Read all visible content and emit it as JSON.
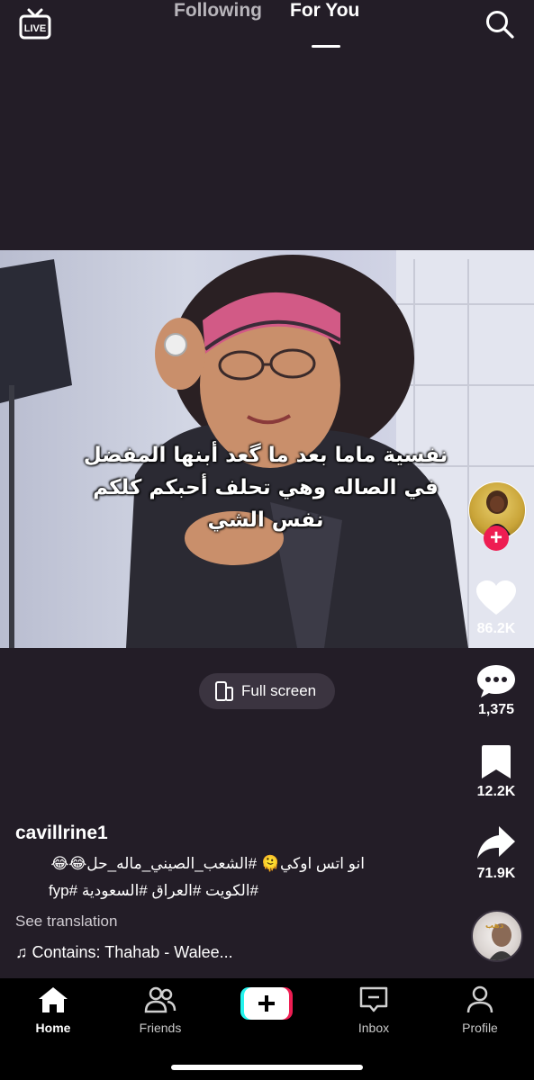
{
  "header": {
    "live_label": "LIVE",
    "tabs": [
      {
        "label": "Following",
        "active": false
      },
      {
        "label": "For You",
        "active": true
      }
    ]
  },
  "video": {
    "subtitle_lines": [
      "نفسية ماما بعد ما گعد أبنها المفضل",
      "في الصاله وهي تحلف أحبكم كلكم",
      "نفس الشي"
    ]
  },
  "fullscreen_label": "Full screen",
  "actions": {
    "likes": "86.2K",
    "comments": "1,375",
    "saves": "12.2K",
    "shares": "71.9K"
  },
  "post": {
    "username": "cavillrine1",
    "caption_line1": "انو اتس اوكي🫠 #الشعب_الصيني_ماله_حل😂😂",
    "caption_line2": "#الكويت #العراق #السعودية  #fyp",
    "see_translation": "See translation",
    "music": "♫ Contains: Thahab - Walee..."
  },
  "nav": {
    "home": "Home",
    "friends": "Friends",
    "inbox": "Inbox",
    "profile": "Profile"
  },
  "colors": {
    "background": "#231d27",
    "accent": "#ee1d52",
    "create_cyan": "#25f4ee"
  }
}
